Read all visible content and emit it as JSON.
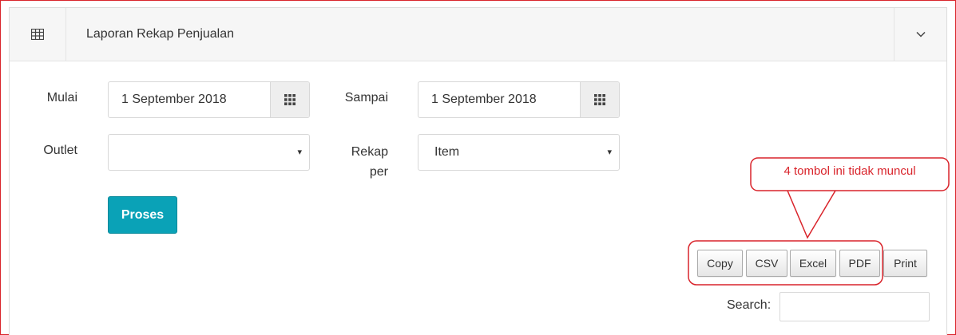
{
  "header": {
    "title": "Laporan Rekap Penjualan",
    "table_icon": "table-icon",
    "collapse_icon": "chevron-down-icon"
  },
  "form": {
    "mulai_label": "Mulai",
    "mulai_value": "1 September 2018",
    "sampai_label": "Sampai",
    "sampai_value": "1 September 2018",
    "calendar_icon": "calendar-grid-icon",
    "outlet_label": "Outlet",
    "outlet_value": "",
    "rekap_label_line1": "Rekap",
    "rekap_label_line2": "per",
    "rekap_value": "Item",
    "select_caret": "▾",
    "proses_label": "Proses"
  },
  "export_buttons": {
    "copy": "Copy",
    "csv": "CSV",
    "excel": "Excel",
    "pdf": "PDF",
    "print": "Print"
  },
  "search": {
    "label": "Search:",
    "value": ""
  },
  "annotation": {
    "text": "4 tombol ini tidak muncul",
    "color": "#d9242b"
  },
  "colors": {
    "accent_button": "#0aa2b7",
    "annotation_red": "#d9242b"
  }
}
